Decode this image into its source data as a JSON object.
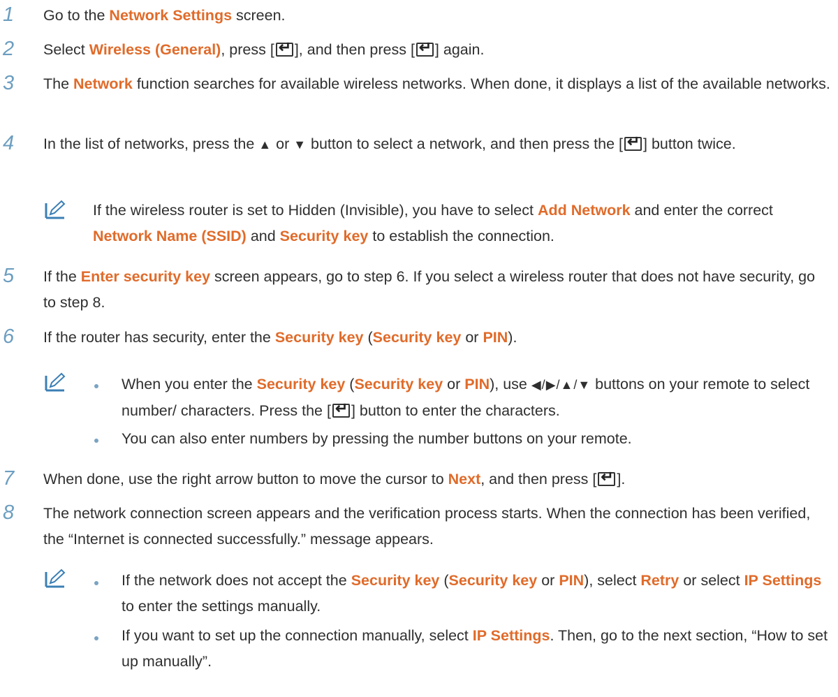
{
  "steps": {
    "s1": {
      "num": "1",
      "a": "Go to the ",
      "b": "Network Settings",
      "c": " screen."
    },
    "s2": {
      "num": "2",
      "a": "Select ",
      "b": "Wireless (General)",
      "c": ", press [",
      "d": "], and then press [",
      "e": "] again."
    },
    "s3": {
      "num": "3",
      "a": "The ",
      "b": "Network",
      "c": " function searches for available wireless networks. When done, it displays a list of the available networks."
    },
    "s4": {
      "num": "4",
      "a": "In the list of networks, press the ",
      "up": "▲",
      "or": " or ",
      "down": "▼",
      "c": " button to select a network, and then press the [",
      "d": "] button twice."
    },
    "s5": {
      "num": "5",
      "a": "If the ",
      "b": "Enter security key",
      "c": " screen appears, go to step 6. If you select a wireless router that does not have security, go to step 8."
    },
    "s6": {
      "num": "6",
      "a": "If the router has security, enter the ",
      "b": "Security key",
      "c": " (",
      "d": "Security key",
      "e": " or ",
      "f": "PIN",
      "g": ")."
    },
    "s7": {
      "num": "7",
      "a": "When done, use the right arrow button to move the cursor to ",
      "b": "Next",
      "c": ", and then press [",
      "d": "]."
    },
    "s8": {
      "num": "8",
      "a": "The network connection screen appears and the verification process starts. When the connection has been verified, the “Internet is connected successfully.” message appears."
    }
  },
  "note1": {
    "a": "If the wireless router is set to Hidden (Invisible), you have to select ",
    "b": "Add Network",
    "c": " and enter the correct ",
    "d": "Network Name (SSID)",
    "e": " and ",
    "f": "Security key",
    "g": " to establish the connection."
  },
  "note2": {
    "b1": {
      "a": "When you enter the ",
      "b": "Security key",
      "c": " (",
      "d": "Security key",
      "e": " or ",
      "f": "PIN",
      "g": "), use ",
      "arrows": "◀/▶/▲/▼",
      "h": " buttons on your remote to select number/ characters. Press the [",
      "i": "] button to enter the characters."
    },
    "b2": {
      "a": "You can also enter numbers by pressing the number buttons on your remote."
    }
  },
  "note3": {
    "b1": {
      "a": "If the network does not accept the ",
      "b": "Security key",
      "c": " (",
      "d": "Security key",
      "e": " or ",
      "f": "PIN",
      "g": "), select ",
      "h": "Retry",
      "i": " or select ",
      "j": "IP Settings",
      "k": " to enter the settings manually."
    },
    "b2": {
      "a": "If you want to set up the connection manually, select ",
      "b": "IP Settings",
      "c": ". Then, go to the next section, “How to set up manually”."
    }
  },
  "icons": {
    "enter": "enter-key-icon",
    "note": "note-pencil-icon"
  },
  "colors": {
    "highlight": "#e06b2a",
    "step_number": "#6c9ec0",
    "note_icon": "#3b7fb5",
    "text": "#2f2f2f"
  }
}
